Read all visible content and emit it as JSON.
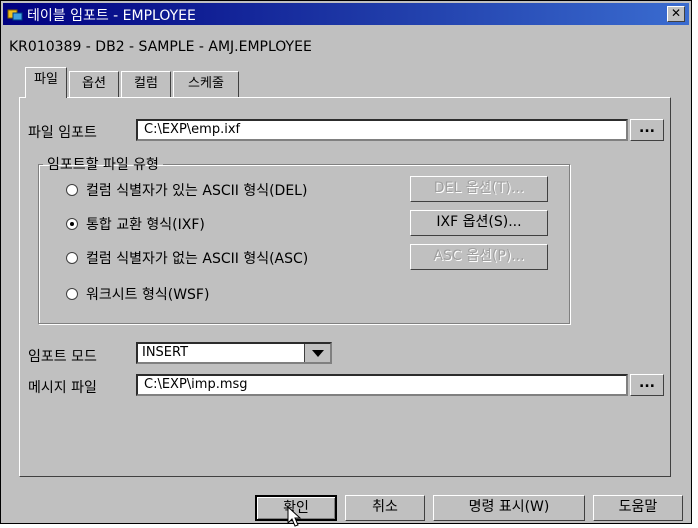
{
  "window": {
    "title": "테이블 임포트 - EMPLOYEE",
    "close_label": "✕"
  },
  "path": "KR010389 - DB2 - SAMPLE - AMJ.EMPLOYEE",
  "tabs": [
    {
      "label": "파일",
      "active": true
    },
    {
      "label": "옵션",
      "active": false
    },
    {
      "label": "컬럼",
      "active": false
    },
    {
      "label": "스케줄",
      "active": false
    }
  ],
  "import_file": {
    "label": "파일 임포트",
    "value": "C:\\EXP\\emp.ixf",
    "browse_label": "..."
  },
  "file_type_group": {
    "legend": "임포트할 파일 유형",
    "options": [
      {
        "label": "컬럼 식별자가 있는 ASCII 형식(DEL)",
        "checked": false,
        "button": "DEL 옵션(T)...",
        "button_enabled": false
      },
      {
        "label": "통합 교환 형식(IXF)",
        "checked": true,
        "button": "IXF 옵션(S)...",
        "button_enabled": true
      },
      {
        "label": "컬럼 식별자가 없는 ASCII 형식(ASC)",
        "checked": false,
        "button": "ASC 옵션(P)...",
        "button_enabled": false
      },
      {
        "label": "워크시트 형식(WSF)",
        "checked": false
      }
    ]
  },
  "import_mode": {
    "label": "임포트 모드",
    "value": "INSERT"
  },
  "message_file": {
    "label": "메시지 파일",
    "value": "C:\\EXP\\imp.msg",
    "browse_label": "..."
  },
  "footer": {
    "ok": "확인",
    "cancel": "취소",
    "show_command": "명령 표시(W)",
    "help": "도움말"
  }
}
